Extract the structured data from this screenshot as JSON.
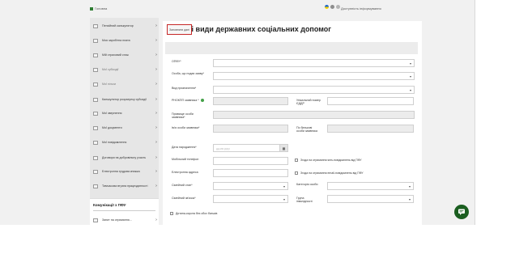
{
  "breadcrumb": {
    "home": "Головна"
  },
  "header": {
    "accessibility": "Доступність інформування"
  },
  "sidebar": {
    "items": [
      {
        "label": "Пенсійний калькулятор"
      },
      {
        "label": "Моя заробітна плата"
      },
      {
        "label": "Мій страховий стаж"
      },
      {
        "label": "Мої субсидії"
      },
      {
        "label": "Мої пільги"
      },
      {
        "label": "Калькулятор розрахунку субсидії"
      },
      {
        "label": "Мої звернення"
      },
      {
        "label": "Мої документи"
      },
      {
        "label": "Мої повідомлення"
      },
      {
        "label": "Договори на добровільну участь"
      },
      {
        "label": "Електронна трудова книжка"
      },
      {
        "label": "Тимчасова втрата працездатності"
      }
    ],
    "comm_title": "Комунікації з ПФУ",
    "comm_items": [
      {
        "label": "Запит на отримання…"
      }
    ]
  },
  "main": {
    "title": "Окремі види державних соціальних допомог",
    "fill_button": "Заповнити дані",
    "labels": {
      "opfu": "ОПФУ*",
      "person": "Особа, що подає заяву*",
      "payment": "Вид призначення*",
      "rnokpp": "РНОКПП заявника *",
      "unzr": "Унікальний номер ЄДДР",
      "surname": "Прізвище особи заявника*",
      "name": "Ім'я особи заявника*",
      "patronymic": "По батькові особи заявника",
      "birth": "Дата народження*",
      "phone": "Мобільний телефон",
      "email": "Електронна адреса",
      "marital": "Сімейний стан*",
      "marital_rel": "Сімейний зв'язок*",
      "category": "Категорія особи",
      "group": "Група інвалідності"
    },
    "birth_placeholder": "дд.мм.рррр",
    "checks": {
      "sms": "Згода на отримання sms-повідомлень від ПФУ",
      "email": "Згода на отримання email-повідомлень від ПФУ",
      "orphan": "Дитина-сирота без обох батьків"
    }
  },
  "colors": {
    "accent": "#2e7d32",
    "highlight": "#c62828",
    "chat": "#1b5e20"
  }
}
